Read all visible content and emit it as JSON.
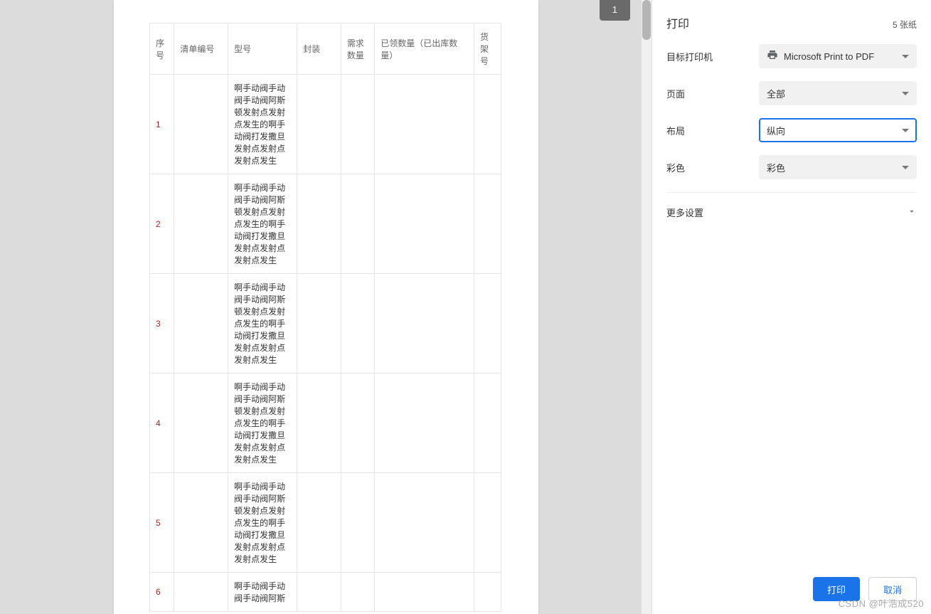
{
  "preview": {
    "page_badge": "1",
    "table": {
      "headers": {
        "seq": "序号",
        "code": "清单编号",
        "model": "型号",
        "pkg": "封装",
        "req": "需求数量",
        "got": "已领数量（已出库数量）",
        "shelf": "货架号"
      },
      "rows": [
        {
          "seq": "1",
          "code": "",
          "model": "啊手动阀手动阀手动阀阿斯顿发射点发射点发生的啊手动阀打发撒旦发射点发射点发射点发生",
          "pkg": "",
          "req": "",
          "got": "",
          "shelf": ""
        },
        {
          "seq": "2",
          "code": "",
          "model": "啊手动阀手动阀手动阀阿斯顿发射点发射点发生的啊手动阀打发撒旦发射点发射点发射点发生",
          "pkg": "",
          "req": "",
          "got": "",
          "shelf": ""
        },
        {
          "seq": "3",
          "code": "",
          "model": "啊手动阀手动阀手动阀阿斯顿发射点发射点发生的啊手动阀打发撒旦发射点发射点发射点发生",
          "pkg": "",
          "req": "",
          "got": "",
          "shelf": ""
        },
        {
          "seq": "4",
          "code": "",
          "model": "啊手动阀手动阀手动阀阿斯顿发射点发射点发生的啊手动阀打发撒旦发射点发射点发射点发生",
          "pkg": "",
          "req": "",
          "got": "",
          "shelf": ""
        },
        {
          "seq": "5",
          "code": "",
          "model": "啊手动阀手动阀手动阀阿斯顿发射点发射点发生的啊手动阀打发撒旦发射点发射点发射点发生",
          "pkg": "",
          "req": "",
          "got": "",
          "shelf": ""
        },
        {
          "seq": "6",
          "code": "",
          "model": "啊手动阀手动阀手动阀阿斯",
          "pkg": "",
          "req": "",
          "got": "",
          "shelf": ""
        }
      ]
    }
  },
  "panel": {
    "title": "打印",
    "page_count": "5 张纸",
    "fields": {
      "printer": {
        "label": "目标打印机",
        "value": "Microsoft Print to PDF",
        "icon": "printer-icon"
      },
      "pages": {
        "label": "页面",
        "value": "全部"
      },
      "layout": {
        "label": "布局",
        "value": "纵向"
      },
      "color": {
        "label": "彩色",
        "value": "彩色"
      }
    },
    "more": "更多设置",
    "buttons": {
      "print": "打印",
      "cancel": "取消"
    }
  },
  "watermark": "CSDN @叶浩成520"
}
